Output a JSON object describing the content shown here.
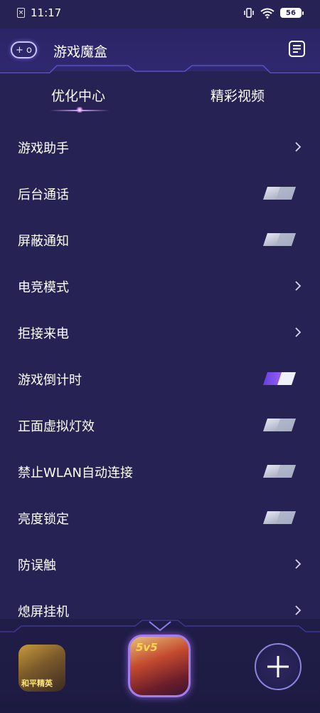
{
  "status_bar": {
    "time": "11:17",
    "battery": "56",
    "sim_icon": "sim-slash-icon",
    "vibrate_icon": "vibrate-icon",
    "wifi_icon": "wifi-icon"
  },
  "header": {
    "title": "游戏魔盒",
    "left_icon": "gamepad-icon",
    "right_icon": "document-list-icon"
  },
  "tabs": [
    {
      "label": "优化中心",
      "active": true
    },
    {
      "label": "精彩视频",
      "active": false
    }
  ],
  "settings": [
    {
      "label": "游戏助手",
      "control": "chevron"
    },
    {
      "label": "后台通话",
      "control": "toggle",
      "on": false
    },
    {
      "label": "屏蔽通知",
      "control": "toggle",
      "on": false
    },
    {
      "label": "电竞模式",
      "control": "chevron"
    },
    {
      "label": "拒接来电",
      "control": "chevron"
    },
    {
      "label": "游戏倒计时",
      "control": "toggle",
      "on": true
    },
    {
      "label": "正面虚拟灯效",
      "control": "toggle",
      "on": false
    },
    {
      "label": "禁止WLAN自动连接",
      "control": "toggle",
      "on": false
    },
    {
      "label": "亮度锁定",
      "control": "toggle",
      "on": false
    },
    {
      "label": "防误触",
      "control": "chevron"
    },
    {
      "label": "熄屏挂机",
      "control": "chevron"
    }
  ],
  "dock": {
    "left_game_label": "和平精英",
    "center_game_badge": "5v5",
    "add_icon": "plus-icon"
  },
  "colors": {
    "background": "#262253",
    "toggle_on": "#8a4df5",
    "toggle_off": "#9aa0b8",
    "accent": "#d9a3ff"
  }
}
